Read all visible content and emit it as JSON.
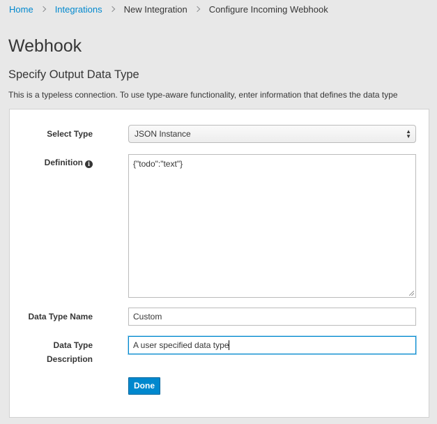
{
  "breadcrumb": {
    "items": [
      {
        "label": "Home",
        "link": true
      },
      {
        "label": "Integrations",
        "link": true
      },
      {
        "label": "New Integration",
        "link": false
      },
      {
        "label": "Configure Incoming Webhook",
        "link": false
      }
    ]
  },
  "page": {
    "title": "Webhook",
    "section_title": "Specify Output Data Type",
    "section_desc": "This is a typeless connection. To use type-aware functionality, enter information that defines the data type"
  },
  "form": {
    "select_type_label": "Select Type",
    "select_type_value": "JSON Instance",
    "definition_label": "Definition",
    "definition_value": "{\"todo\":\"text\"}",
    "data_type_name_label": "Data Type Name",
    "data_type_name_value": "Custom",
    "data_type_desc_label_line1": "Data Type",
    "data_type_desc_label_line2": "Description",
    "data_type_desc_value": "A user specified data type",
    "done_label": "Done"
  },
  "colors": {
    "link": "#0088ce",
    "primary_button": "#0088ce",
    "background": "#e8e8e8"
  }
}
